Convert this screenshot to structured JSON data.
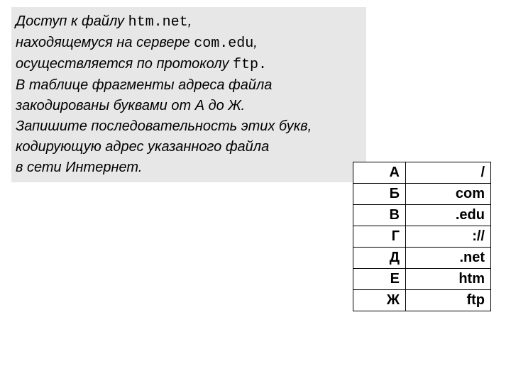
{
  "question": {
    "line1_pre": "Доступ к файлу ",
    "line1_mono": "htm.net",
    "line1_post": ",",
    "line2_pre": "находящемуся на сервере ",
    "line2_mono": "com.edu",
    "line2_post": ",",
    "line3_pre": " осуществляется по протоколу ",
    "line3_mono": "ftp.",
    "line4": "В таблице фрагменты адреса файла",
    "line5": " закодированы буквами от А до Ж.",
    "line6": "Запишите последовательность этих букв,",
    "line7": " кодирующую адрес указанного файла",
    "line8": " в сети Интернет."
  },
  "fragments": [
    {
      "letter": "А",
      "value": "/"
    },
    {
      "letter": "Б",
      "value": "com"
    },
    {
      "letter": "В",
      "value": ".edu"
    },
    {
      "letter": "Г",
      "value": "://"
    },
    {
      "letter": "Д",
      "value": ".net"
    },
    {
      "letter": "Е",
      "value": "htm"
    },
    {
      "letter": "Ж",
      "value": "ftp"
    }
  ]
}
